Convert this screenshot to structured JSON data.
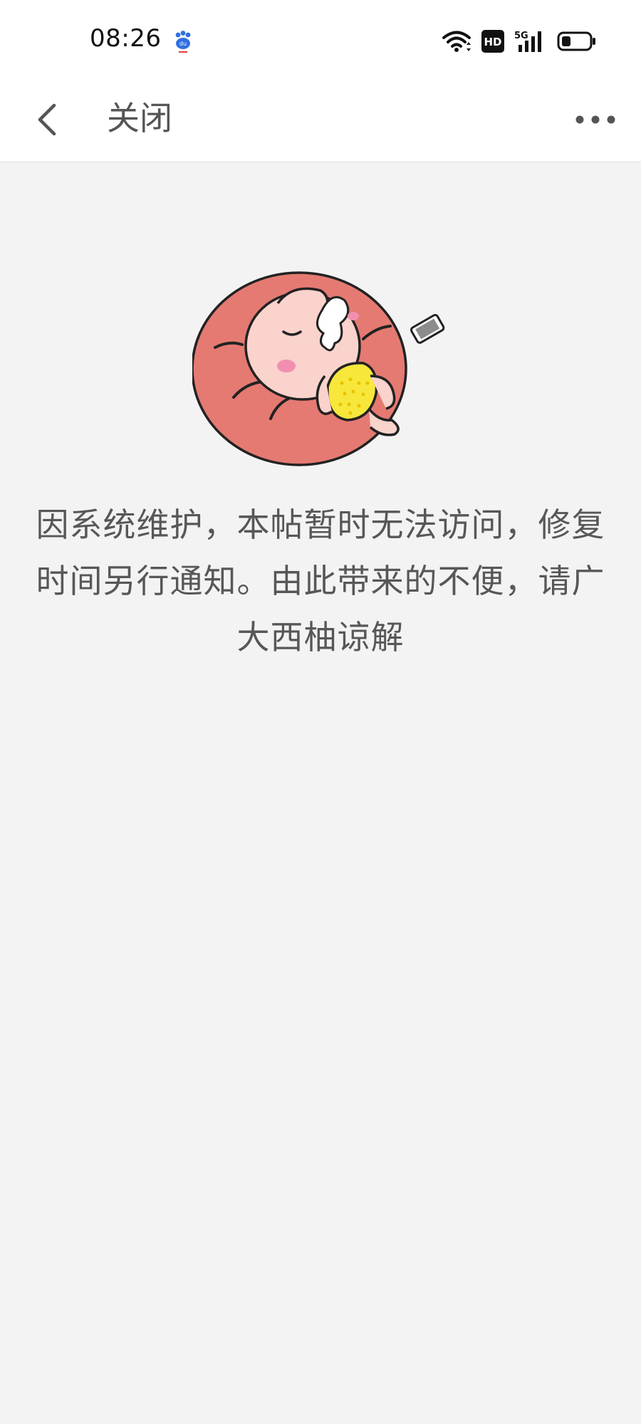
{
  "status_bar": {
    "time": "08:26",
    "notification_icon": "baidu-paw-icon",
    "icons": [
      "wifi-icon",
      "hd-icon",
      "5g-signal-icon",
      "battery-icon"
    ],
    "network_label": "5G",
    "hd_label": "HD"
  },
  "nav": {
    "back_icon": "chevron-left-icon",
    "title": "关闭",
    "more_icon": "more-dots-icon"
  },
  "content": {
    "illustration": "sleeping-cartoon-on-beanbag",
    "message": "因系统维护，本帖暂时无法访问，修复时间另行通知。由此带来的不便，请广大西柚谅解"
  },
  "colors": {
    "background": "#f3f3f3",
    "bar": "#ffffff",
    "text": "#575757",
    "beanbag": "#e57a72",
    "shirt": "#f7e73a"
  }
}
